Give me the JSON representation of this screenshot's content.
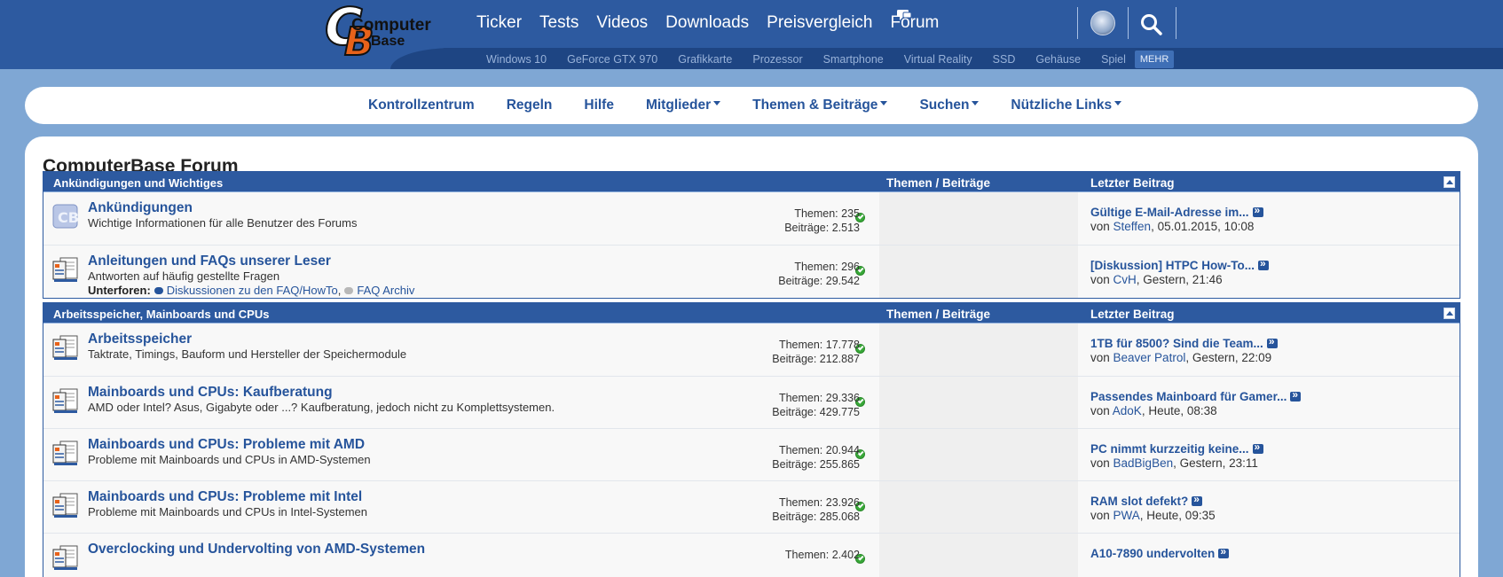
{
  "logo": {
    "line1": "Computer",
    "line2": "Base",
    "letter_c": "C",
    "letter_b": "B"
  },
  "main_nav": [
    "Ticker",
    "Tests",
    "Videos",
    "Downloads",
    "Preisvergleich",
    "Forum"
  ],
  "sub_nav": [
    "Windows 10",
    "GeForce GTX 970",
    "Grafikkarte",
    "Prozessor",
    "Smartphone",
    "Virtual Reality",
    "SSD",
    "Gehäuse",
    "Spiel"
  ],
  "sub_nav_more": "MEHR",
  "forum_nav": [
    {
      "label": "Kontrollzentrum",
      "dropdown": false
    },
    {
      "label": "Regeln",
      "dropdown": false
    },
    {
      "label": "Hilfe",
      "dropdown": false
    },
    {
      "label": "Mitglieder",
      "dropdown": true
    },
    {
      "label": "Themen & Beiträge",
      "dropdown": true
    },
    {
      "label": "Suchen",
      "dropdown": true
    },
    {
      "label": "Nützliche Links",
      "dropdown": true
    }
  ],
  "page_title": "ComputerBase Forum",
  "colors": {
    "header": "#2d5aa0",
    "subbar": "#1e4583",
    "background": "#7fa7d4",
    "link": "#26549b",
    "status_ok": "#38a838"
  },
  "sections": [
    {
      "name": "Ankündigungen und Wichtiges",
      "col_stats": "Themen / Beiträge",
      "col_last": "Letzter Beitrag",
      "forums": [
        {
          "icon": "cb-announcement-icon",
          "name": "Ankündigungen",
          "description": "Wichtige Informationen für alle Benutzer des Forums",
          "themen": "Themen: 235",
          "beitraege": "Beiträge: 2.513",
          "last_title": "Gültige E-Mail-Adresse im...",
          "last_prefix": "von ",
          "last_user": "Steffen",
          "last_time": ", 05.01.2015, 10:08"
        },
        {
          "icon": "forum-document-icon",
          "name": "Anleitungen und FAQs unserer Leser",
          "description": "Antworten auf häufig gestellte Fragen",
          "subforums_label": "Unterforen:",
          "subforums": [
            {
              "label": "Diskussionen zu den FAQ/HowTo",
              "suffix": ",",
              "bubble": "blue"
            },
            {
              "label": "FAQ Archiv",
              "suffix": "",
              "bubble": "grey"
            }
          ],
          "themen": "Themen: 296",
          "beitraege": "Beiträge: 29.542",
          "last_title": "[Diskussion] HTPC How-To...",
          "last_prefix": "von ",
          "last_user": "CvH",
          "last_time": ", Gestern, 21:46"
        }
      ]
    },
    {
      "name": "Arbeitsspeicher, Mainboards und CPUs",
      "col_stats": "Themen / Beiträge",
      "col_last": "Letzter Beitrag",
      "forums": [
        {
          "icon": "forum-document-icon",
          "name": "Arbeitsspeicher",
          "description": "Taktrate, Timings, Bauform und Hersteller der Speichermodule",
          "themen": "Themen: 17.778",
          "beitraege": "Beiträge: 212.887",
          "last_title": "1TB für 8500? Sind die Team...",
          "last_prefix": "von ",
          "last_user": "Beaver Patrol",
          "last_time": ", Gestern, 22:09"
        },
        {
          "icon": "forum-document-icon",
          "name": "Mainboards und CPUs: Kaufberatung",
          "description": "AMD oder Intel? Asus, Gigabyte oder ...? Kaufberatung, jedoch nicht zu Komplettsystemen.",
          "themen": "Themen: 29.336",
          "beitraege": "Beiträge: 429.775",
          "last_title": "Passendes Mainboard für Gamer...",
          "last_prefix": "von ",
          "last_user": "AdoK",
          "last_time": ", Heute, 08:38"
        },
        {
          "icon": "forum-document-icon",
          "name": "Mainboards und CPUs: Probleme mit AMD",
          "description": "Probleme mit Mainboards und CPUs in AMD-Systemen",
          "themen": "Themen: 20.944",
          "beitraege": "Beiträge: 255.865",
          "last_title": "PC nimmt kurzzeitig keine...",
          "last_prefix": "von ",
          "last_user": "BadBigBen",
          "last_time": ", Gestern, 23:11"
        },
        {
          "icon": "forum-document-icon",
          "name": "Mainboards und CPUs: Probleme mit Intel",
          "description": "Probleme mit Mainboards und CPUs in Intel-Systemen",
          "themen": "Themen: 23.926",
          "beitraege": "Beiträge: 285.068",
          "last_title": "RAM slot defekt?",
          "last_prefix": "von ",
          "last_user": "PWA",
          "last_time": ", Heute, 09:35"
        },
        {
          "icon": "forum-document-icon",
          "name": "Overclocking und Undervolting von AMD-Systemen",
          "description": "",
          "themen": "Themen: 2.402",
          "beitraege": "",
          "last_title": "A10-7890 undervolten",
          "last_prefix": "",
          "last_user": "",
          "last_time": ""
        }
      ]
    }
  ]
}
